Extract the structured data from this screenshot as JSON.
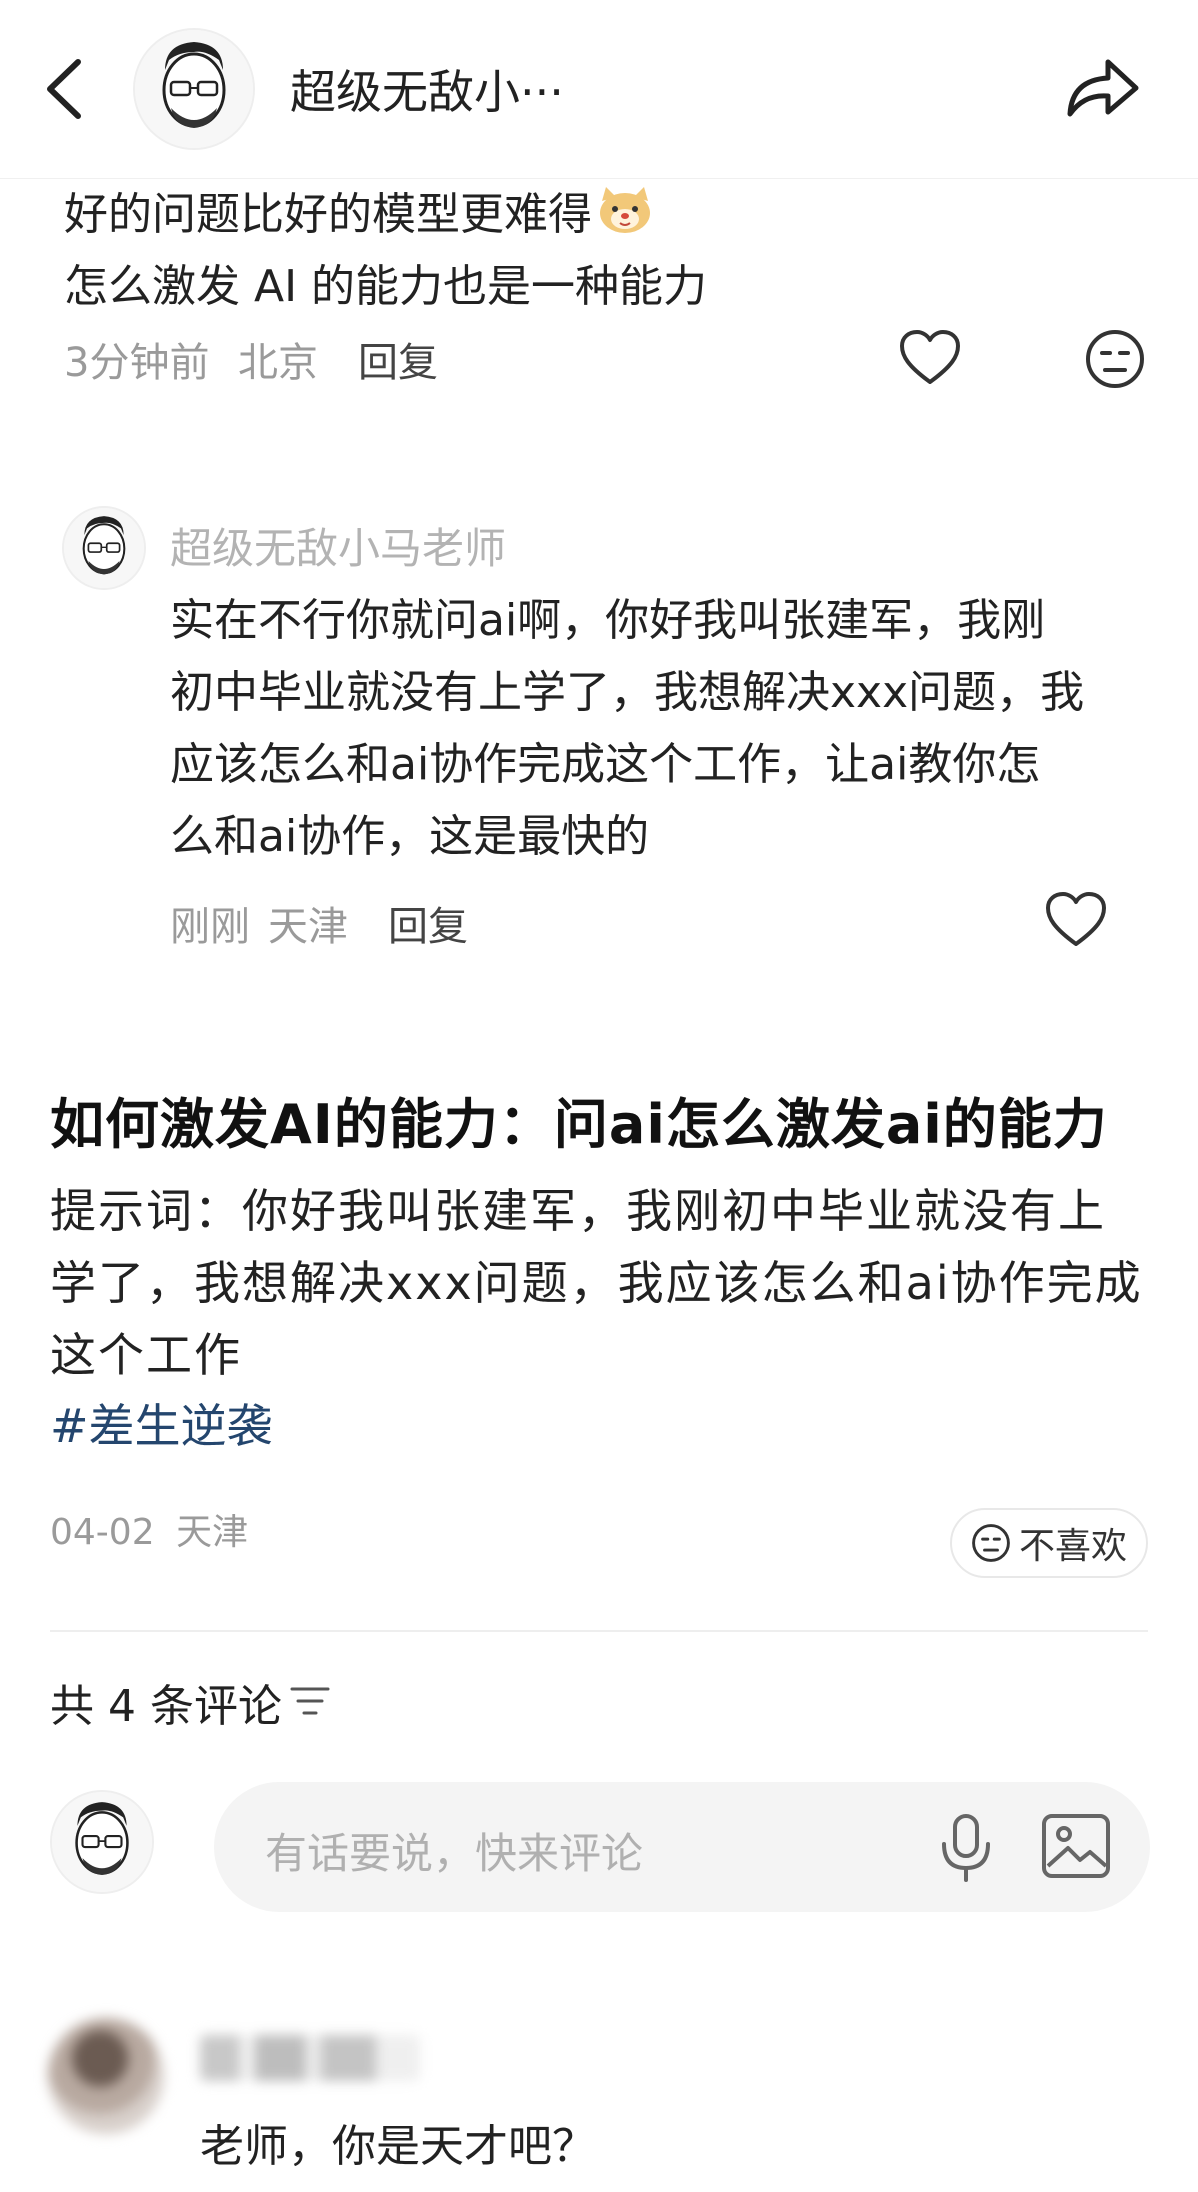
{
  "header": {
    "title": "超级无敌小···",
    "back_icon": "chevron-left-icon",
    "share_icon": "share-arrow-icon"
  },
  "top_comment": {
    "line1": "好的问题比好的模型更难得",
    "line2": "怎么激发 AI 的能力也是一种能力",
    "time": "3分钟前",
    "location": "北京",
    "reply_label": "回复",
    "icons": [
      "heart-icon",
      "dislike-face-icon"
    ]
  },
  "sub_reply": {
    "author": "超级无敌小马老师",
    "lines": [
      "实在不行你就问ai啊，你好我叫张建军，我刚",
      "初中毕业就没有上学了，我想解决xxx问题，我",
      "应该怎么和ai协作完成这个工作，让ai教你怎",
      "么和ai协作，这是最快的"
    ],
    "time": "刚刚",
    "location": "天津",
    "reply_label": "回复"
  },
  "post": {
    "title": "如何激发AI的能力：问ai怎么激发ai的能力",
    "body_lines": [
      "提示词：你好我叫张建军，我刚初中毕业就没有上",
      "学了，我想解决xxx问题，我应该怎么和ai协作完成",
      "这个工作"
    ],
    "hashtag": "#差生逆袭",
    "date": "04-02",
    "location": "天津",
    "dislike_label": "不喜欢"
  },
  "comments_section": {
    "count_label": "共 4 条评论",
    "sort_icon": "sort-lines-icon",
    "input_placeholder": "有话要说，快来评论",
    "input_icons": [
      "microphone-icon",
      "image-icon"
    ]
  },
  "bottom_comment": {
    "text": "老师，你是天才吧？"
  },
  "colors": {
    "hashtag": "#24466e",
    "meta_text": "#9a9a9a",
    "input_bg": "#f4f4f4"
  }
}
